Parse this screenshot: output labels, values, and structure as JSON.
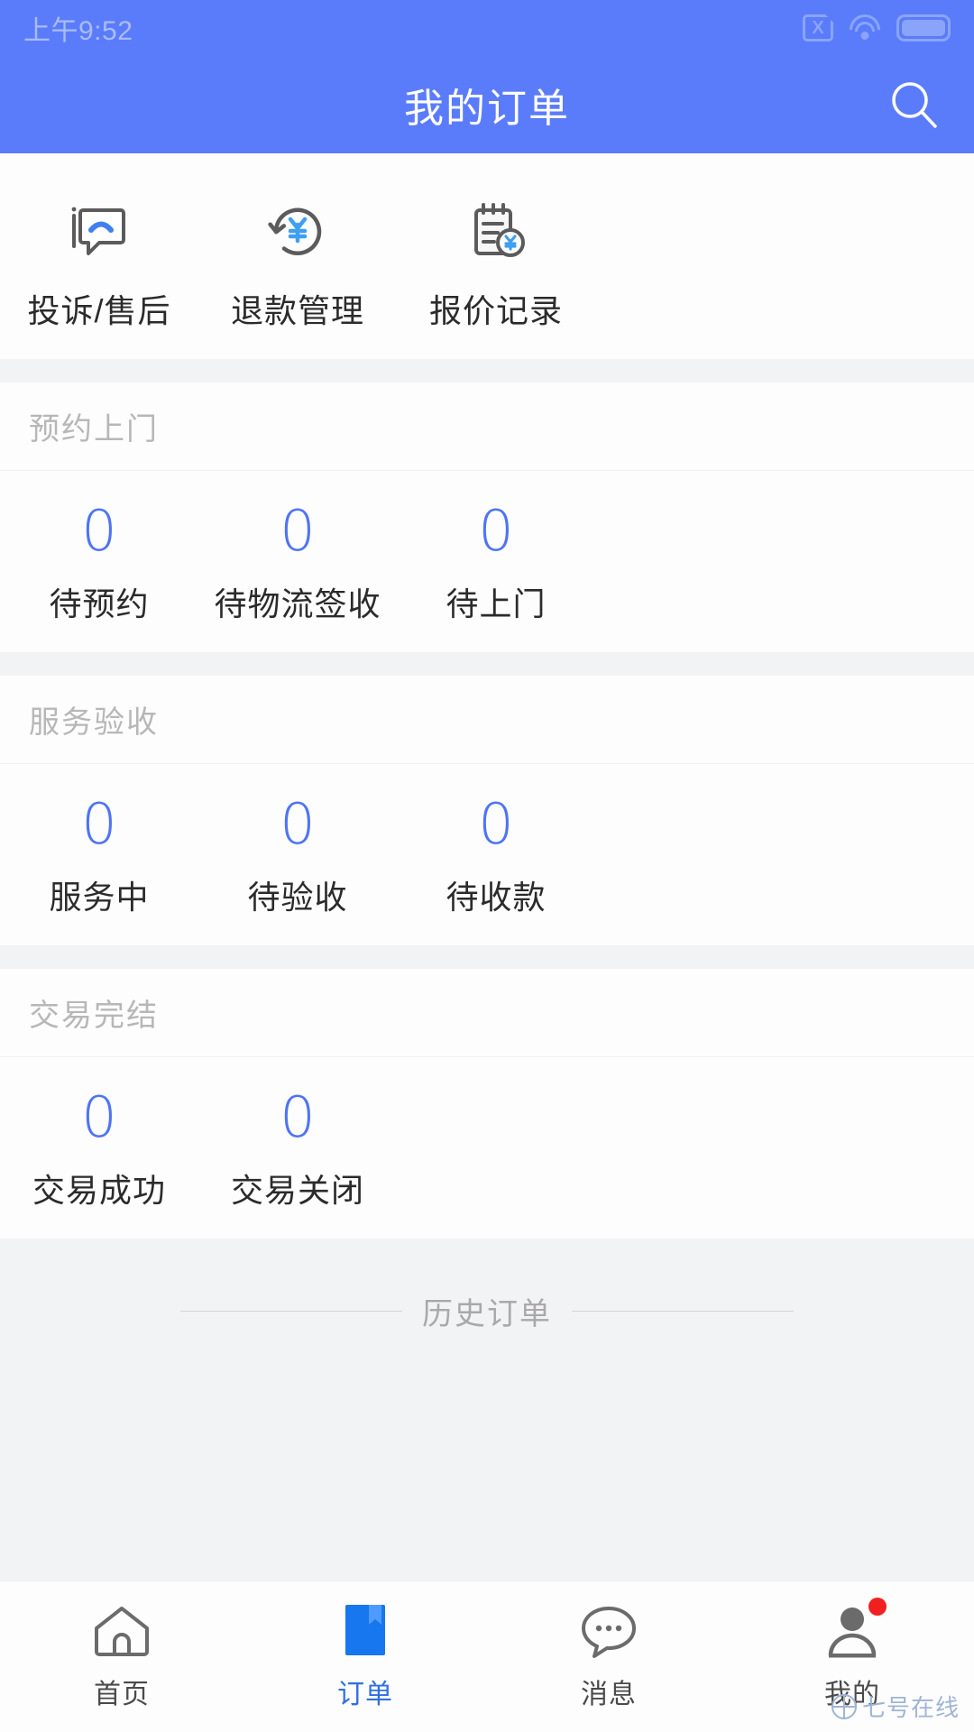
{
  "status_bar": {
    "time": "上午9:52",
    "icons": [
      "sim-no-card-icon",
      "wifi-icon",
      "battery-icon"
    ]
  },
  "app_bar": {
    "title": "我的订单",
    "search_icon": "search-icon"
  },
  "quick_actions": [
    {
      "label": "投诉/售后",
      "icon": "complaint-chat-icon"
    },
    {
      "label": "退款管理",
      "icon": "refund-yuan-icon"
    },
    {
      "label": "报价记录",
      "icon": "quotation-record-icon"
    }
  ],
  "sections": [
    {
      "title": "预约上门",
      "items": [
        {
          "count": "0",
          "label": "待预约"
        },
        {
          "count": "0",
          "label": "待物流签收"
        },
        {
          "count": "0",
          "label": "待上门"
        }
      ]
    },
    {
      "title": "服务验收",
      "items": [
        {
          "count": "0",
          "label": "服务中"
        },
        {
          "count": "0",
          "label": "待验收"
        },
        {
          "count": "0",
          "label": "待收款"
        }
      ]
    },
    {
      "title": "交易完结",
      "items": [
        {
          "count": "0",
          "label": "交易成功"
        },
        {
          "count": "0",
          "label": "交易关闭"
        }
      ]
    }
  ],
  "history_divider": {
    "label": "历史订单"
  },
  "tab_bar": {
    "items": [
      {
        "label": "首页",
        "icon": "home-icon",
        "active": false,
        "badge": false
      },
      {
        "label": "订单",
        "icon": "order-icon",
        "active": true,
        "badge": false
      },
      {
        "label": "消息",
        "icon": "message-icon",
        "active": false,
        "badge": false
      },
      {
        "label": "我的",
        "icon": "profile-icon",
        "active": false,
        "badge": true
      }
    ]
  },
  "watermark": {
    "text": "七号在线",
    "icon": "globe-icon"
  },
  "colors": {
    "brand_blue": "#5b7cfa",
    "count_blue": "#4e74f5",
    "active_tab": "#2f6fe0",
    "page_bg": "#f2f3f5",
    "card_bg": "#fdfdfd",
    "badge_red": "#f02020"
  }
}
